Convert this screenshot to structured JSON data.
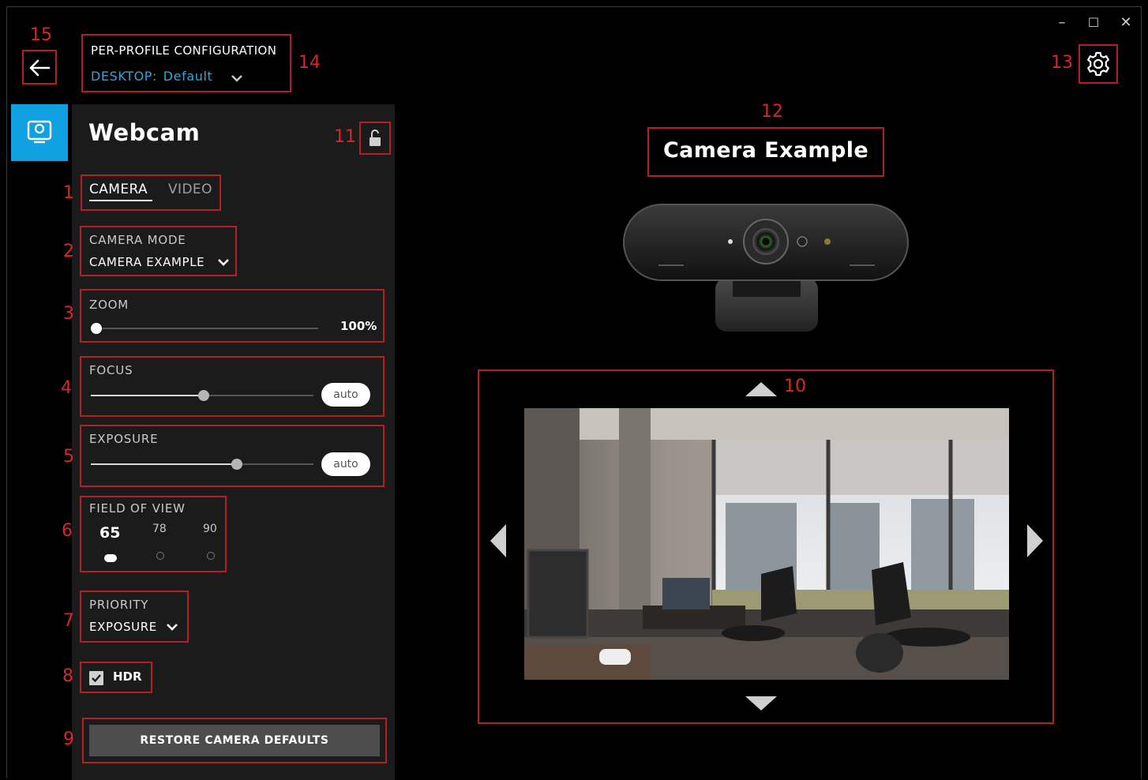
{
  "header": {
    "profile_heading": "PER-PROFILE CONFIGURATION",
    "profile_prefix": "DESKTOP:",
    "profile_value": "Default"
  },
  "window_controls": {
    "minimize": "–",
    "maximize": "☐",
    "close": "✕"
  },
  "device": {
    "name": "Webcam",
    "tabs": [
      "CAMERA",
      "VIDEO"
    ],
    "active_tab": "CAMERA"
  },
  "camera_mode": {
    "label": "CAMERA MODE",
    "value": "CAMERA EXAMPLE"
  },
  "zoom": {
    "label": "ZOOM",
    "value_text": "100%",
    "value": 1.0
  },
  "focus": {
    "label": "FOCUS",
    "value": 0.5,
    "auto_label": "auto"
  },
  "exposure": {
    "label": "EXPOSURE",
    "value": 0.66,
    "auto_label": "auto"
  },
  "field_of_view": {
    "label": "FIELD OF VIEW",
    "options": [
      "65",
      "78",
      "90"
    ],
    "selected": "65"
  },
  "priority": {
    "label": "PRIORITY",
    "value": "EXPOSURE"
  },
  "hdr": {
    "label": "HDR",
    "checked": true
  },
  "restore_button": "RESTORE CAMERA DEFAULTS",
  "preview": {
    "title": "Camera Example"
  },
  "annotations": [
    "1",
    "2",
    "3",
    "4",
    "5",
    "6",
    "7",
    "8",
    "9",
    "10",
    "11",
    "12",
    "13",
    "14",
    "15"
  ],
  "colors": {
    "accent": "#10a1e3",
    "annotation": "#d8262c",
    "panel": "#1b1b1b",
    "profile_link": "#2aa8df"
  },
  "icons": [
    "back-arrow-icon",
    "chevron-down-icon",
    "webcam-icon",
    "unlock-icon",
    "gear-icon",
    "checkbox-check-icon",
    "arrow-up-icon",
    "arrow-down-icon",
    "arrow-left-icon",
    "arrow-right-icon"
  ]
}
